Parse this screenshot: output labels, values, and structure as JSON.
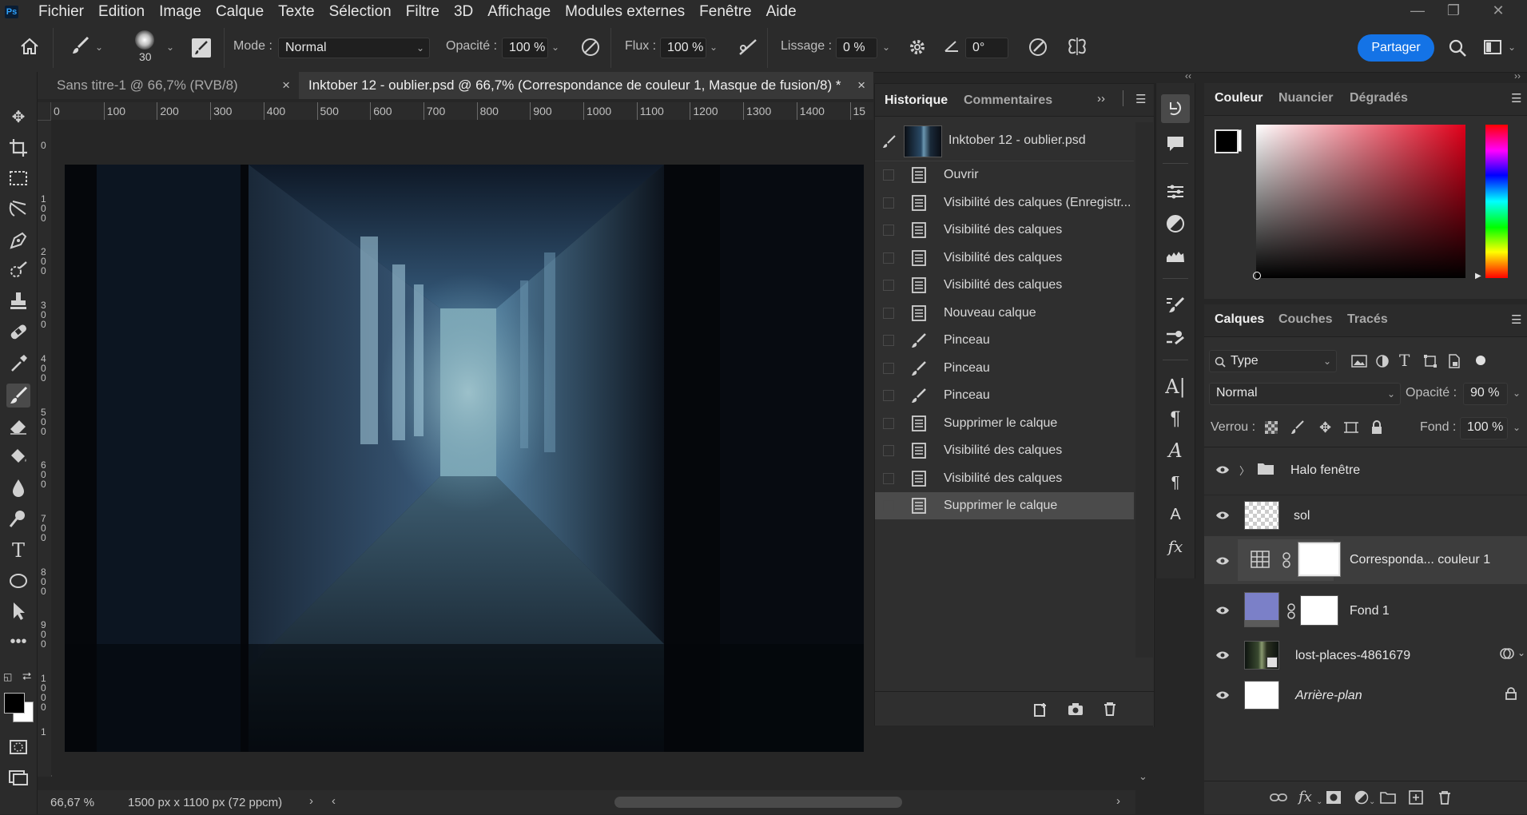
{
  "menu": {
    "logo": "Ps",
    "items": [
      "Fichier",
      "Edition",
      "Image",
      "Calque",
      "Texte",
      "Sélection",
      "Filtre",
      "3D",
      "Affichage",
      "Modules externes",
      "Fenêtre",
      "Aide"
    ]
  },
  "options": {
    "brush_size": "30",
    "mode_label": "Mode :",
    "mode_value": "Normal",
    "opacity_label": "Opacité :",
    "opacity_value": "100 %",
    "flow_label": "Flux :",
    "flow_value": "100 %",
    "smoothing_label": "Lissage :",
    "smoothing_value": "0 %",
    "angle_value": "0°",
    "share_label": "Partager"
  },
  "tabs": [
    {
      "label": "Sans titre-1 @ 66,7% (RVB/8)",
      "active": false
    },
    {
      "label": "Inktober 12 - oublier.psd @ 66,7% (Correspondance de couleur 1, Masque de fusion/8) *",
      "active": true
    }
  ],
  "ruler": {
    "top_ticks": [
      "0",
      "100",
      "200",
      "300",
      "400",
      "500",
      "600",
      "700",
      "800",
      "900",
      "1000",
      "1100",
      "1200",
      "1300",
      "1400",
      "15"
    ],
    "left_ticks": [
      "0",
      "1 0 0",
      "2 0 0",
      "3 0 0",
      "4 0 0",
      "5 0 0",
      "6 0 0",
      "7 0 0",
      "8 0 0",
      "9 0 0",
      "1 0 0 0",
      "1"
    ]
  },
  "status": {
    "zoom": "66,67 %",
    "doc_info": "1500 px x 1100 px (72 ppcm)"
  },
  "history": {
    "tab_active": "Historique",
    "tab_other": "Commentaires",
    "snapshot": "Inktober 12 - oublier.psd",
    "items": [
      {
        "label": "Ouvrir",
        "icon": "document-icon"
      },
      {
        "label": "Visibilité des calques (Enregistr...",
        "icon": "document-icon"
      },
      {
        "label": "Visibilité des calques",
        "icon": "document-icon"
      },
      {
        "label": "Visibilité des calques",
        "icon": "document-icon"
      },
      {
        "label": "Visibilité des calques",
        "icon": "document-icon"
      },
      {
        "label": "Nouveau calque",
        "icon": "document-icon"
      },
      {
        "label": "Pinceau",
        "icon": "brush-icon"
      },
      {
        "label": "Pinceau",
        "icon": "brush-icon"
      },
      {
        "label": "Pinceau",
        "icon": "brush-icon"
      },
      {
        "label": "Supprimer le calque",
        "icon": "document-icon"
      },
      {
        "label": "Visibilité des calques",
        "icon": "document-icon"
      },
      {
        "label": "Visibilité des calques",
        "icon": "document-icon"
      },
      {
        "label": "Supprimer le calque",
        "icon": "document-icon"
      }
    ]
  },
  "color_panel": {
    "tabs": [
      "Couleur",
      "Nuancier",
      "Dégradés"
    ],
    "foreground": "#000000",
    "background": "#ffffff",
    "hue_color": "#e0001a"
  },
  "layers_panel": {
    "tabs": [
      "Calques",
      "Couches",
      "Tracés"
    ],
    "filter_label": "Type",
    "blend_mode": "Normal",
    "opacity_label": "Opacité :",
    "opacity_value": "90 %",
    "lock_label": "Verrou :",
    "fill_label": "Fond :",
    "fill_value": "100 %",
    "layers": [
      {
        "name": "Halo fenêtre",
        "kind": "group"
      },
      {
        "name": "sol",
        "kind": "transparent"
      },
      {
        "name": "Correspondа... couleur 1",
        "kind": "adjustment",
        "selected": true
      },
      {
        "name": "Fond 1",
        "kind": "fill",
        "color": "#7b80c8"
      },
      {
        "name": "lost-places-4861679",
        "kind": "smart"
      },
      {
        "name": "Arrière-plan",
        "kind": "background",
        "locked": true
      }
    ]
  }
}
